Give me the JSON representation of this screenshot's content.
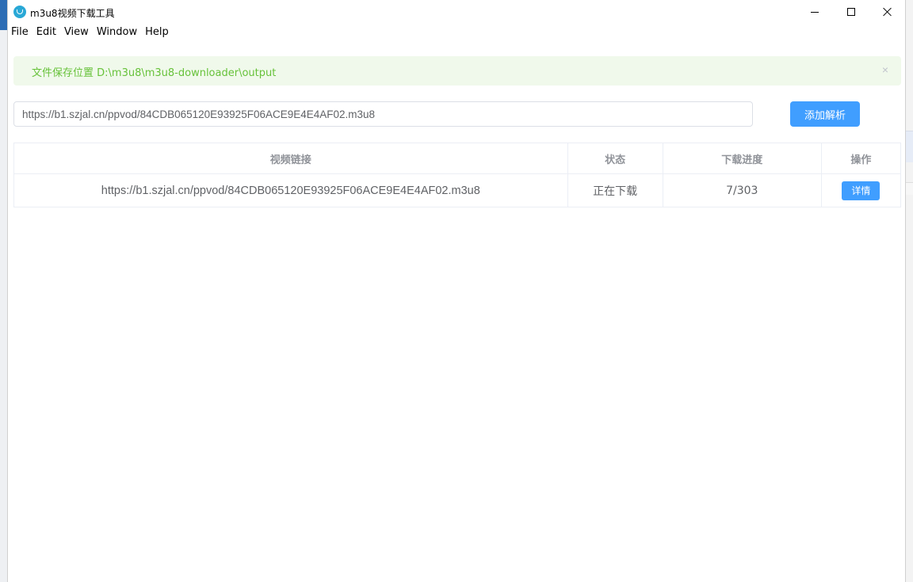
{
  "window": {
    "title": "m3u8视频下载工具",
    "controls": [
      "minimize",
      "maximize",
      "close"
    ]
  },
  "menu": [
    "File",
    "Edit",
    "View",
    "Window",
    "Help"
  ],
  "alert": {
    "message": "文件保存位置 D:\\m3u8\\m3u8-downloader\\output",
    "close": "×",
    "color": "#67c23a",
    "background": "#f0f9eb"
  },
  "input": {
    "value": "https://b1.szjal.cn/ppvod/84CDB065120E93925F06ACE9E4E4AF02.m3u8"
  },
  "add_button": {
    "label": "添加解析",
    "color": "#409eff"
  },
  "table": {
    "columns": [
      "视频链接",
      "状态",
      "下载进度",
      "操作"
    ],
    "rows": [
      {
        "url": "https://b1.szjal.cn/ppvod/84CDB065120E93925F06ACE9E4E4AF02.m3u8",
        "status": "正在下载",
        "progress": "7/303",
        "action": "详情"
      }
    ]
  },
  "icons": {
    "app": "app-logo-icon",
    "minimize": "minimize-icon",
    "maximize": "maximize-icon",
    "close": "close-icon"
  }
}
